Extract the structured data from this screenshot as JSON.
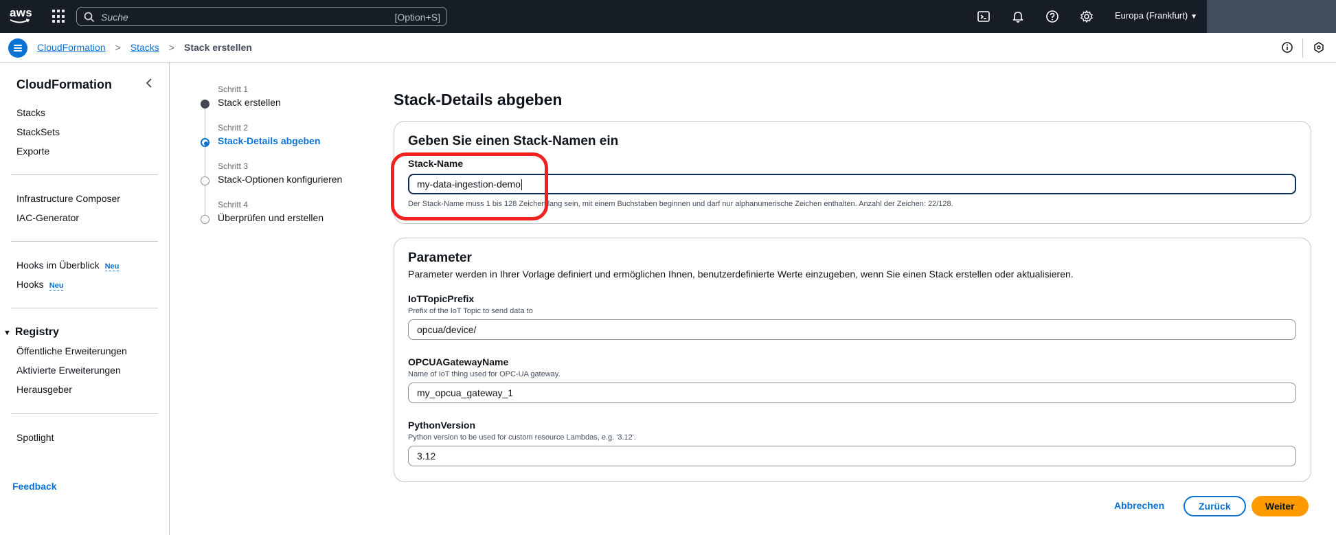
{
  "topnav": {
    "logo_text": "aws",
    "search_placeholder": "Suche",
    "search_shortcut": "[Option+S]",
    "region": "Europa (Frankfurt)",
    "icons": [
      "cloudshell-icon",
      "bell-icon",
      "help-icon",
      "gear-icon"
    ]
  },
  "breadcrumb": {
    "items": [
      "CloudFormation",
      "Stacks"
    ],
    "current": "Stack erstellen"
  },
  "sidenav": {
    "title": "CloudFormation",
    "group1": [
      "Stacks",
      "StackSets",
      "Exporte"
    ],
    "group2": [
      "Infrastructure Composer",
      "IAC-Generator"
    ],
    "hooks_overview": "Hooks im Überblick",
    "hooks": "Hooks",
    "new_badge": "Neu",
    "registry_title": "Registry",
    "registry_items": [
      "Öffentliche Erweiterungen",
      "Aktivierte Erweiterungen",
      "Herausgeber"
    ],
    "spotlight": "Spotlight",
    "feedback": "Feedback"
  },
  "wizard": {
    "steps": [
      {
        "num": "Schritt 1",
        "label": "Stack erstellen",
        "state": "done"
      },
      {
        "num": "Schritt 2",
        "label": "Stack-Details abgeben",
        "state": "active"
      },
      {
        "num": "Schritt 3",
        "label": "Stack-Optionen konfigurieren",
        "state": "pending"
      },
      {
        "num": "Schritt 4",
        "label": "Überprüfen und erstellen",
        "state": "pending"
      }
    ]
  },
  "main": {
    "title": "Stack-Details abgeben",
    "stack_name_section": {
      "heading": "Geben Sie einen Stack-Namen ein",
      "label": "Stack-Name",
      "value": "my-data-ingestion-demo",
      "constraint": "Der Stack-Name muss 1 bis 128 Zeichen lang sein, mit einem Buchstaben beginnen und darf nur alphanumerische Zeichen enthalten. Anzahl der Zeichen: 22/128."
    },
    "parameters_section": {
      "heading": "Parameter",
      "description": "Parameter werden in Ihrer Vorlage definiert und ermöglichen Ihnen, benutzerdefinierte Werte einzugeben, wenn Sie einen Stack erstellen oder aktualisieren.",
      "params": [
        {
          "name": "IoTTopicPrefix",
          "desc": "Prefix of the IoT Topic to send data to",
          "value": "opcua/device/"
        },
        {
          "name": "OPCUAGatewayName",
          "desc": "Name of IoT thing used for OPC-UA gateway.",
          "value": "my_opcua_gateway_1"
        },
        {
          "name": "PythonVersion",
          "desc": "Python version to be used for custom resource Lambdas, e.g. '3.12'.",
          "value": "3.12"
        }
      ]
    },
    "actions": {
      "cancel": "Abbrechen",
      "back": "Zurück",
      "next": "Weiter"
    }
  }
}
